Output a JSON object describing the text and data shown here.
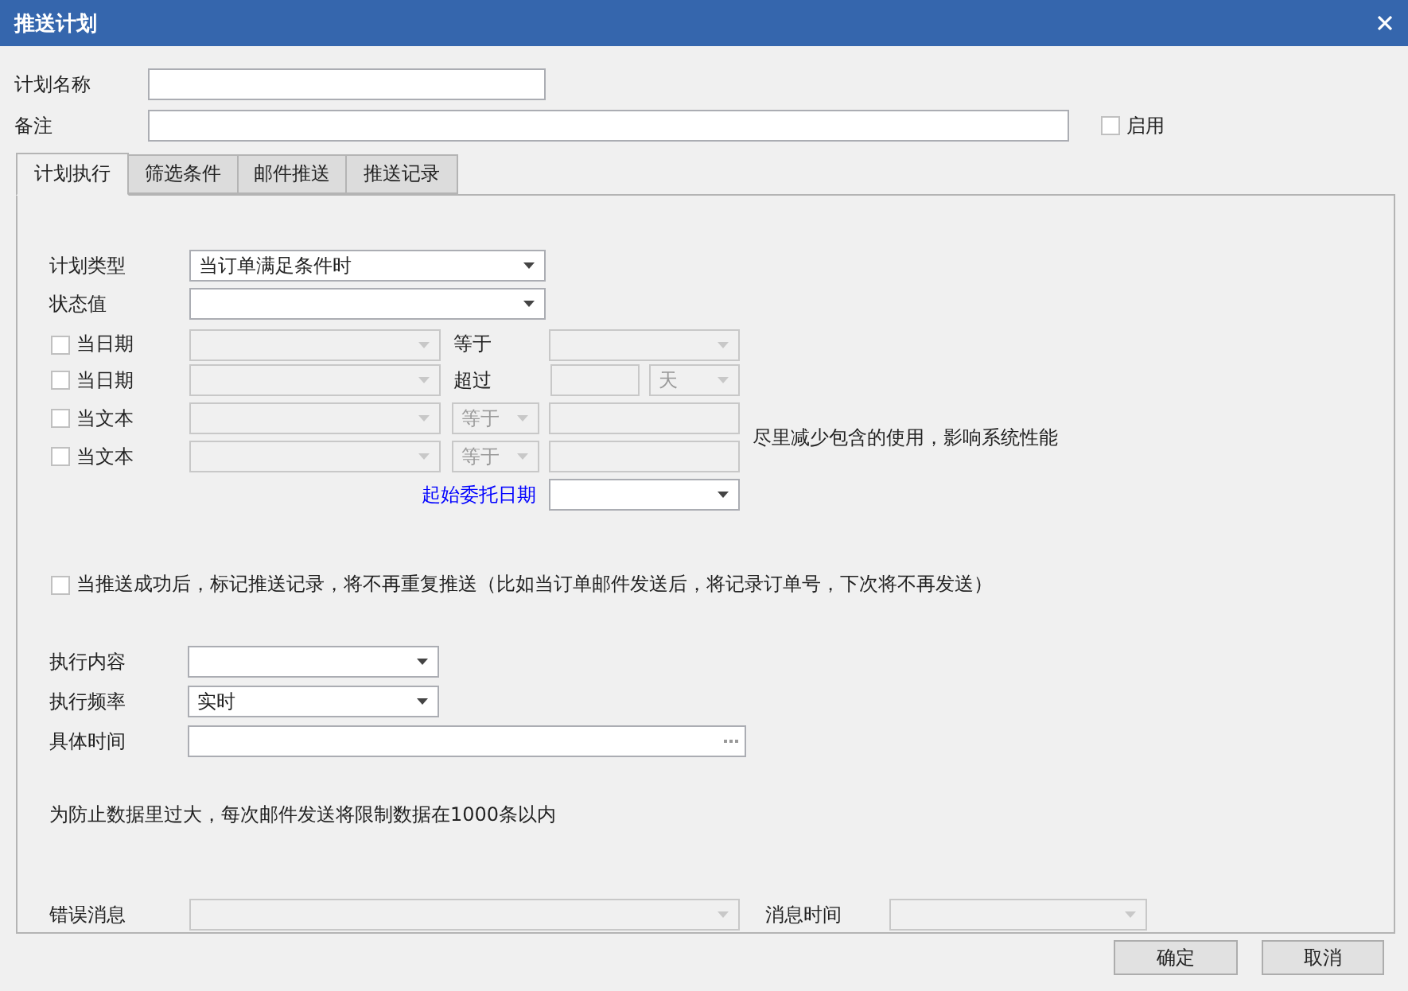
{
  "window": {
    "title": "推送计划"
  },
  "plan_name": {
    "label": "计划名称"
  },
  "remark": {
    "label": "备注"
  },
  "enabled": {
    "label": "启用",
    "checked": false
  },
  "tabs": [
    {
      "label": "计划执行",
      "selected": true
    },
    {
      "label": "筛选条件",
      "selected": false
    },
    {
      "label": "邮件推送",
      "selected": false
    },
    {
      "label": "推送记录",
      "selected": false
    }
  ],
  "plan_type": {
    "label": "计划类型",
    "value": "当订单满足条件时"
  },
  "status_value": {
    "label": "状态值"
  },
  "conditions": [
    {
      "label": "当日期",
      "checked": false,
      "field_disabled": true,
      "operator": {
        "kind": "label",
        "text": "等于"
      },
      "values": [
        {
          "kind": "dropdown",
          "disabled": true
        }
      ]
    },
    {
      "label": "当日期",
      "checked": false,
      "field_disabled": true,
      "operator": {
        "kind": "label",
        "text": "超过"
      },
      "values": [
        {
          "kind": "text",
          "disabled": true
        },
        {
          "kind": "dropdown",
          "disabled": true,
          "value": "天"
        }
      ]
    },
    {
      "label": "当文本",
      "checked": false,
      "field_disabled": true,
      "operator": {
        "kind": "dropdown",
        "text": "等于",
        "disabled": true
      },
      "values": [
        {
          "kind": "text",
          "disabled": true
        }
      ]
    },
    {
      "label": "当文本",
      "checked": false,
      "field_disabled": true,
      "operator": {
        "kind": "dropdown",
        "text": "等于",
        "disabled": true
      },
      "values": [
        {
          "kind": "text",
          "disabled": true
        }
      ]
    }
  ],
  "condition_note": "尽里减少包含的使用，影响系统性能",
  "start_date": {
    "label": "起始委托日期"
  },
  "mark_sent": {
    "label": "当推送成功后，标记推送记录，将不再重复推送（比如当订单邮件发送后，将记录订单号，下次将不再发送）",
    "checked": false
  },
  "exec_content": {
    "label": "执行内容"
  },
  "exec_frequency": {
    "label": "执行频率",
    "value": "实时"
  },
  "specific_time": {
    "label": "具体时间"
  },
  "limit_note": "为防止数据里过大，每次邮件发送将限制数据在1000条以内",
  "error_message": {
    "label": "错误消息",
    "disabled": true
  },
  "message_time": {
    "label": "消息时间",
    "disabled": true
  },
  "buttons": [
    "确定",
    "取消"
  ]
}
